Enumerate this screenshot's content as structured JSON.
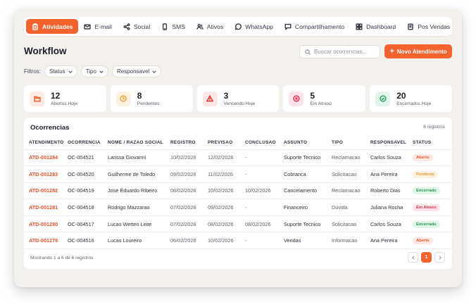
{
  "nav": {
    "items": [
      {
        "label": "Atividades",
        "icon": "clipboard-icon",
        "active": true
      },
      {
        "label": "E-mail",
        "icon": "mail-icon"
      },
      {
        "label": "Social",
        "icon": "share-icon"
      },
      {
        "label": "SMS",
        "icon": "phone-icon"
      },
      {
        "label": "Ativos",
        "icon": "users-icon"
      },
      {
        "label": "WhatsApp",
        "icon": "whatsapp-icon"
      },
      {
        "label": "Compartilhamento",
        "icon": "chat-icon"
      },
      {
        "label": "Dashboard",
        "icon": "grid-icon"
      },
      {
        "label": "Pos Vendas",
        "icon": "receipt-icon"
      }
    ]
  },
  "page": {
    "title": "Workflow",
    "search_placeholder": "Buscar ocorrencias...",
    "new_button": "Novo Atendimento"
  },
  "filters": {
    "label": "Filtros:",
    "chips": [
      "Status",
      "Tipo",
      "Responsavel"
    ]
  },
  "stats": [
    {
      "value": "12",
      "label": "Abertos Hoje",
      "color": "#f4622d",
      "bg": "#fdebe3",
      "icon": "folder-icon"
    },
    {
      "value": "8",
      "label": "Pendentes",
      "color": "#f0a23a",
      "bg": "#fdf1e1",
      "icon": "clock-icon"
    },
    {
      "value": "3",
      "label": "Vencendo Hoje",
      "color": "#e03a3a",
      "bg": "#fde6e6",
      "icon": "warning-icon"
    },
    {
      "value": "5",
      "label": "Em Atraso",
      "color": "#e0355a",
      "bg": "#fde4ea",
      "icon": "x-circle-icon"
    },
    {
      "value": "20",
      "label": "Encerrados Hoje",
      "color": "#2aa85e",
      "bg": "#e2f5e9",
      "icon": "check-circle-icon"
    }
  ],
  "table": {
    "title": "Ocorrencias",
    "count": "6 registros",
    "columns": [
      "ATENDIMENTO",
      "OCORRENCIA",
      "NOME / RAZAO SOCIAL",
      "REGISTRO",
      "PREVISAO",
      "CONCLUSAO",
      "ASSUNTO",
      "TIPO",
      "RESPONSAVEL",
      "STATUS"
    ],
    "rows": [
      [
        "ATD-001284",
        "OC-004521",
        "Larissa Giovanni",
        "10/02/2026",
        "12/02/2026",
        "-",
        "Suporte Tecnico",
        "Reclamacao",
        "Carlos Souza",
        "Aberto"
      ],
      [
        "ATD-001283",
        "OC-004520",
        "Guilherme de Toledo",
        "09/02/2026",
        "11/02/2026",
        "-",
        "Cobranca",
        "Solicitacao",
        "Ana Pereira",
        "Pendente"
      ],
      [
        "ATD-001282",
        "OC-004519",
        "Jose Eduardo Ribeiro",
        "08/02/2026",
        "10/02/2026",
        "10/02/2026",
        "Cancelamento",
        "Reclamacao",
        "Roberto Dias",
        "Encerrado"
      ],
      [
        "ATD-001281",
        "OC-004518",
        "Rodrigo Mazzarao",
        "07/02/2026",
        "09/02/2026",
        "-",
        "Financeiro",
        "Duvida",
        "Juliana Rocha",
        "Em Atraso"
      ],
      [
        "ATD-001280",
        "OC-004517",
        "Lucas Wetten Leite",
        "07/02/2026",
        "08/02/2026",
        "08/02/2026",
        "Suporte Tecnico",
        "Solicitacao",
        "Carlos Souza",
        "Encerrado"
      ],
      [
        "ATD-001279",
        "OC-004516",
        "Lucas Loureiro",
        "06/02/2026",
        "10/02/2026",
        "-",
        "Vendas",
        "Informacao",
        "Ana Pereira",
        "Aberto"
      ]
    ],
    "status_colors": {
      "Aberto": {
        "fg": "#e2552b",
        "bg": "#fde9e1"
      },
      "Pendente": {
        "fg": "#e59a2e",
        "bg": "#fdf2e2"
      },
      "Encerrado": {
        "fg": "#23944f",
        "bg": "#e0f4e7"
      },
      "Em Atraso": {
        "fg": "#d9324a",
        "bg": "#fde2e7"
      }
    },
    "footer": "Mostrando 1 a 6 de 6 registros",
    "current_page": "1"
  }
}
